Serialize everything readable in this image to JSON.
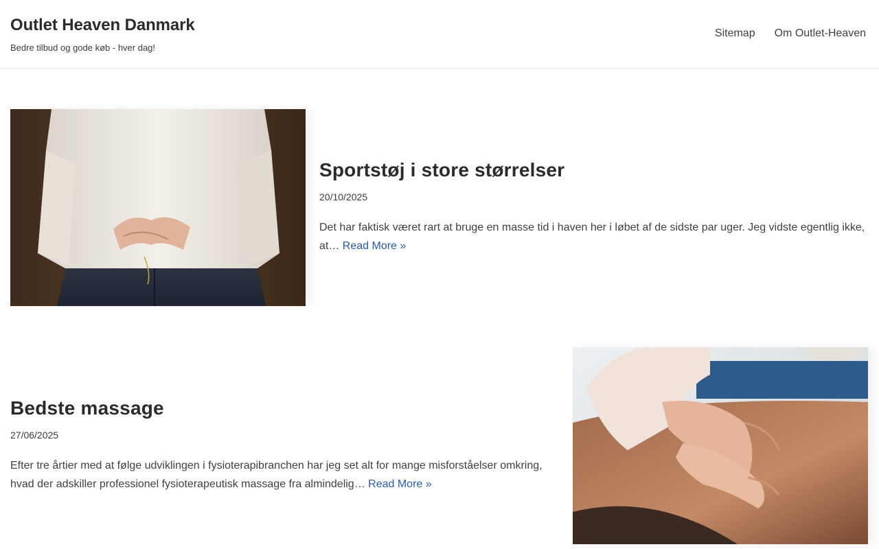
{
  "site": {
    "title": "Outlet Heaven Danmark",
    "tagline": "Bedre tilbud og gode køb - hver dag!"
  },
  "nav": {
    "items": [
      {
        "label": "Sitemap"
      },
      {
        "label": "Om Outlet-Heaven"
      }
    ]
  },
  "posts": [
    {
      "title": "Sportstøj i store størrelser",
      "date": "20/10/2025",
      "excerpt": "Det har faktisk været rart at bruge en masse tid i haven her i løbet af de sidste par uger. Jeg vidste egentlig ikke, at…",
      "read_more": "Read More »",
      "image": "person-in-white-sweater-and-jeans"
    },
    {
      "title": "Bedste massage",
      "date": "27/06/2025",
      "excerpt": "Efter tre årtier med at følge udviklingen i fysioterapibranchen har jeg set alt for mange misforståelser omkring, hvad der adskiller professionel fysioterapeutisk massage fra almindelig…",
      "read_more": "Read More »",
      "image": "back-massage"
    }
  ],
  "colors": {
    "link": "#2a5aa8",
    "heading": "#2b2b2b",
    "text": "#404040"
  }
}
